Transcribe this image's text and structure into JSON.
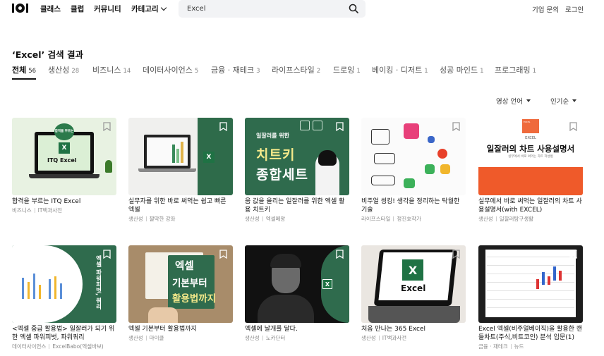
{
  "nav": {
    "links": [
      "클래스",
      "클럽",
      "커뮤니티",
      "카테고리"
    ],
    "search_value": "Excel",
    "util_links": [
      "기업 문의",
      "로그인"
    ]
  },
  "result": {
    "title": "‘Excel’ 검색 결과"
  },
  "tabs": [
    {
      "label": "전체",
      "count": "56",
      "active": true
    },
    {
      "label": "생산성",
      "count": "28"
    },
    {
      "label": "비즈니스",
      "count": "14"
    },
    {
      "label": "데이터사이언스",
      "count": "5"
    },
    {
      "label": "금융 · 재테크",
      "count": "3"
    },
    {
      "label": "라이프스타일",
      "count": "2"
    },
    {
      "label": "드로잉",
      "count": "1"
    },
    {
      "label": "베이킹 · 디저트",
      "count": "1"
    },
    {
      "label": "성공 마인드",
      "count": "1"
    },
    {
      "label": "프로그래밍",
      "count": "1"
    }
  ],
  "filters": {
    "language": "영상 언어",
    "sort": "인기순"
  },
  "thumb_text": {
    "itq_badge": "합격을 부르는",
    "itq_label": "ITQ Excel",
    "chitki_sub": "일잘러를 위한",
    "chitki_main1": "치트키",
    "chitki_main2": "종합세트",
    "chart_book": "EXCEL",
    "chart_ex": "EXCEL",
    "chart_big": "일잘러의 차트 사용설명서",
    "chart_small": "실무에서 바로 써먹는 차트 작성법",
    "pivot_vtext": "엑셀 파워피벗, 쿼리",
    "basic_l1": "엑셀",
    "basic_l2": "기본부터",
    "basic_l3": "활용법까지",
    "excel_word": "Excel",
    "xl_letter": "X"
  },
  "cards": [
    {
      "title": "합격을 부르는 ITQ Excel",
      "category": "비즈니스",
      "creator": "IT백과사전"
    },
    {
      "title": "실무자를 위한 바로 써먹는 쉽고 빠른 엑셀",
      "category": "생산성",
      "creator": "짤막한 강좌"
    },
    {
      "title": "움 값을 올리는 일잘러를 위한 엑셀 활용 치트키",
      "category": "생산성",
      "creator": "엑셀메왕"
    },
    {
      "title": "비주얼 씽킹! 생각을 정리하는 탁월한 기술",
      "category": "라이프스타일",
      "creator": "정진호작가"
    },
    {
      "title": "실무에서 바로 써먹는 일잘러의 차트 사용설명서(with EXCEL)",
      "category": "생산성",
      "creator": "일잘러탐구생활"
    },
    {
      "title": "<엑셀 중급 활용법> 일잘러가 되기 위한 엑셀 파워피벗, 파워쿼리",
      "category": "데이터사이언스",
      "creator": "ExcelBabo(엑셀바보)"
    },
    {
      "title": "엑셀 기본부터 활용법까지",
      "category": "생산성",
      "creator": "마이클"
    },
    {
      "title": "엑셀에 날개를 달다.",
      "category": "생산성",
      "creator": "노카단터"
    },
    {
      "title": "처음 만나는 365 Excel",
      "category": "생산성",
      "creator": "IT백과사전"
    },
    {
      "title": "Excel 엑셀(비주얼베이직)을 활용한 캔들차트(주식,비트코인) 분석 입문(1)",
      "category": "금융 · 재테크",
      "creator": "뉴드"
    }
  ],
  "colors": {
    "accent_green": "#2f6b4d",
    "excel_green": "#1f7244",
    "orange": "#ef5a2a"
  }
}
